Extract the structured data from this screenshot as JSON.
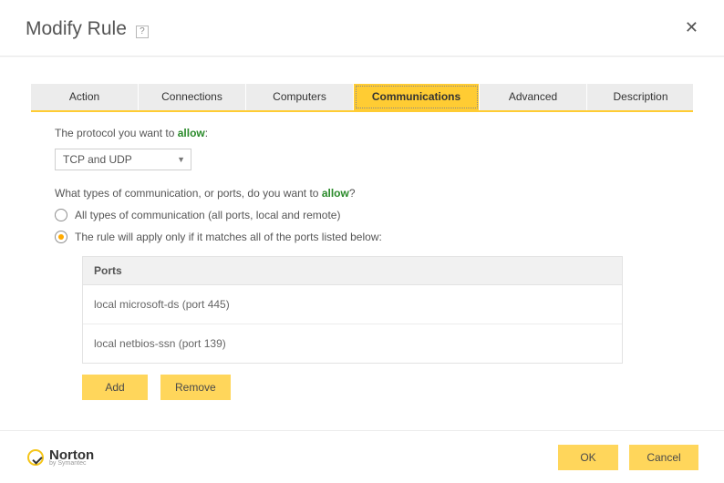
{
  "title": "Modify Rule",
  "help_glyph": "?",
  "tabs": [
    {
      "label": "Action"
    },
    {
      "label": "Connections"
    },
    {
      "label": "Computers"
    },
    {
      "label": "Communications"
    },
    {
      "label": "Advanced"
    },
    {
      "label": "Description"
    }
  ],
  "active_tab_index": 3,
  "panel": {
    "protocol_label_pre": "The protocol you want to ",
    "protocol_allow_word": "allow",
    "protocol_label_post": ":",
    "protocol_value": "TCP and UDP",
    "ports_question_pre": "What types of communication, or ports, do you want to ",
    "ports_allow_word": "allow",
    "ports_question_post": "?",
    "radio_all": "All types of communication (all ports, local and remote)",
    "radio_match": "The rule will apply only if it matches all of the ports listed below:",
    "selected_radio": "match",
    "ports_header": "Ports",
    "ports": [
      "local microsoft-ds (port 445)",
      "local netbios-ssn (port 139)"
    ],
    "add_label": "Add",
    "remove_label": "Remove"
  },
  "footer": {
    "brand": "Norton",
    "brand_sub": "by Symantec",
    "ok_label": "OK",
    "cancel_label": "Cancel"
  }
}
